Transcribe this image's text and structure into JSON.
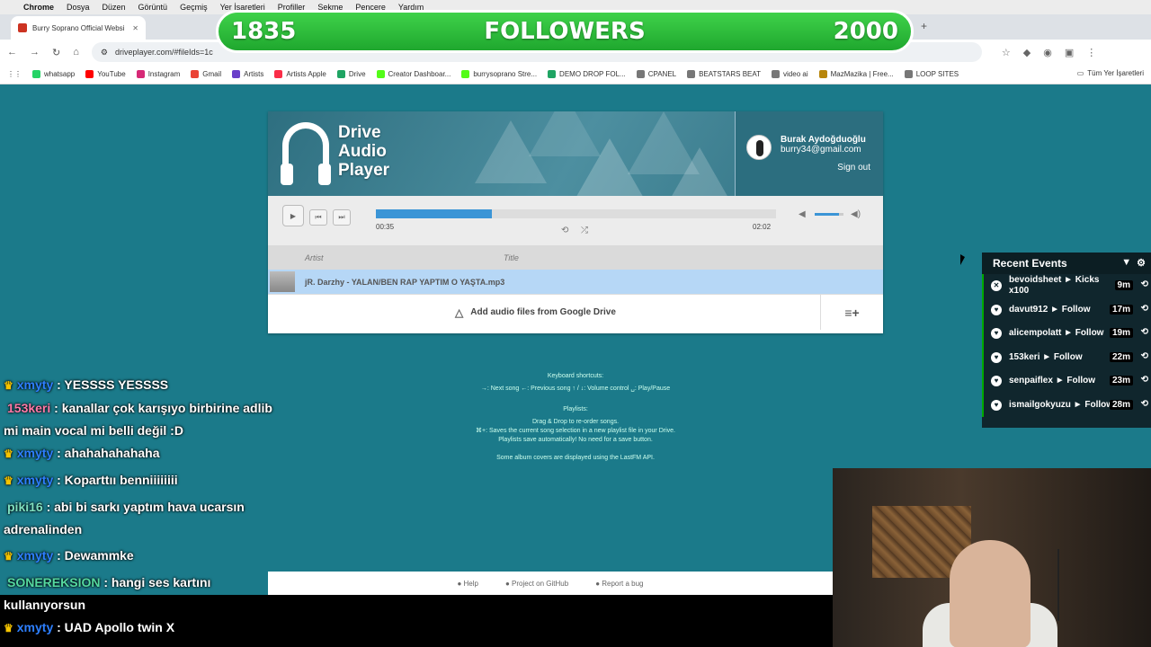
{
  "menubar": {
    "items": [
      "Chrome",
      "Dosya",
      "Düzen",
      "Görüntü",
      "Geçmiş",
      "Yer İşaretleri",
      "Profiller",
      "Sekme",
      "Pencere",
      "Yardım"
    ]
  },
  "tab": {
    "title": "Burry Soprano Official Websi"
  },
  "address": {
    "url": "driveplayer.com/#fileIds=1c"
  },
  "bookmarks": {
    "items": [
      "whatsapp",
      "YouTube",
      "Instagram",
      "Gmail",
      "Artists",
      "Artists Apple",
      "Drive",
      "Creator Dashboar...",
      "burrysoprano Stre...",
      "DEMO DROP FOL...",
      "CPANEL",
      "BEATSTARS BEAT",
      "video ai",
      "MazMazika | Free...",
      "LOOP SITES"
    ],
    "right": "Tüm Yer İşaretleri"
  },
  "followers": {
    "current": "1835",
    "label": "FOLLOWERS",
    "goal": "2000"
  },
  "player": {
    "logo": [
      "Drive",
      "Audio",
      "Player"
    ],
    "user_name": "Burak Aydoğduoğlu",
    "user_email": "burry34@gmail.com",
    "sign_out": "Sign out",
    "elapsed": "00:35",
    "duration": "02:02",
    "progress_pct": 29,
    "volume_pct": 85,
    "col_artist": "Artist",
    "col_title": "Title",
    "track": "jR. Darzhy - YALAN/BEN RAP YAPTIM O YAŞTA.mp3",
    "add_files": "Add audio files from Google Drive"
  },
  "info": {
    "shortcuts_title": "Keyboard shortcuts:",
    "shortcuts": "→: Next song  ←: Previous song  ↑ / ↓: Volume control  ␣: Play/Pause",
    "playlists_title": "Playlists:",
    "playlists_1": "Drag & Drop to re-order songs.",
    "playlists_2": "⌘+: Saves the current song selection in a new playlist file in your Drive.",
    "playlists_3": "Playlists save automatically! No need for a save button.",
    "lastfm": "Some album covers are displayed using the LastFM API."
  },
  "footer": {
    "help": "Help",
    "github": "Project on GitHub",
    "bug": "Report a bug"
  },
  "events": {
    "title": "Recent Events",
    "items": [
      {
        "text": "bevoidsheet ► Kicks x100",
        "time": "9m"
      },
      {
        "text": "davut912 ► Follow",
        "time": "17m"
      },
      {
        "text": "alicempolatt ► Follow",
        "time": "19m"
      },
      {
        "text": "153keri ► Follow",
        "time": "22m"
      },
      {
        "text": "senpaiflex ► Follow",
        "time": "23m"
      },
      {
        "text": "ismailgokyuzu ► Follow",
        "time": "28m"
      }
    ]
  },
  "chat": [
    {
      "user": "xmyty",
      "msg": ": YESSSS YESSSS"
    },
    {
      "user": "153keri",
      "msg": ": kanallar çok karışıyo birbirine adlib mi main vocal mi belli değil :D"
    },
    {
      "user": "xmyty",
      "msg": ": ahahahahahaha"
    },
    {
      "user": "xmyty",
      "msg": ": Koparttıı benniiiiiiii"
    },
    {
      "user": "piki16",
      "msg": ": abi bi sarkı yaptım hava ucarsın adrenalinden"
    },
    {
      "user": "xmyty",
      "msg": ": Dewammke"
    },
    {
      "user": "SONEREKSION",
      "msg": ": hangi ses kartını kullanıyorsun"
    },
    {
      "user": "xmyty",
      "msg": ": UAD Apollo twin X"
    }
  ]
}
